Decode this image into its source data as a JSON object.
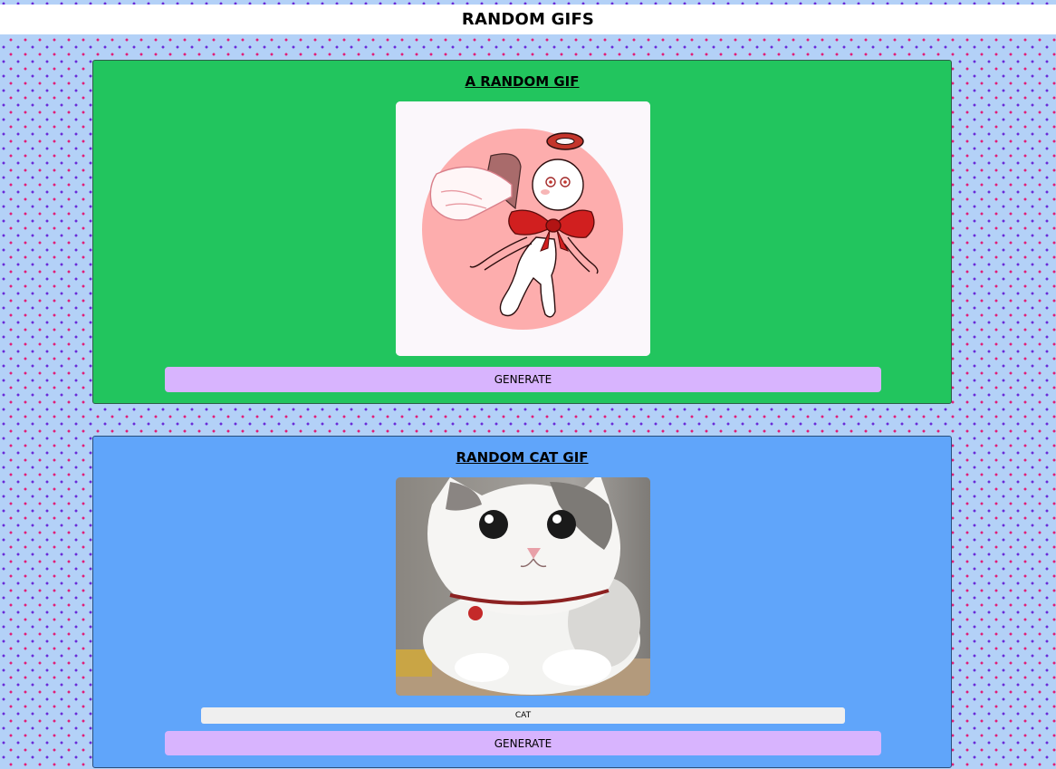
{
  "header": {
    "title": "RANDOM GIFS"
  },
  "random_gif": {
    "title": "A RANDOM GIF",
    "image_label": "angel-character-gif",
    "button_label": "GENERATE",
    "accent_color": "#22c55e"
  },
  "cat_gif": {
    "title": "RANDOM CAT GIF",
    "image_label": "cat-gif",
    "tag_input_value": "CAT",
    "button_label": "GENERATE",
    "accent_color": "#60a5fa"
  },
  "colors": {
    "page_background": "#b3d1f7",
    "button_background": "#d8b4fe",
    "dot_pink": "#e01e78",
    "dot_purple": "#6a2bd8"
  }
}
